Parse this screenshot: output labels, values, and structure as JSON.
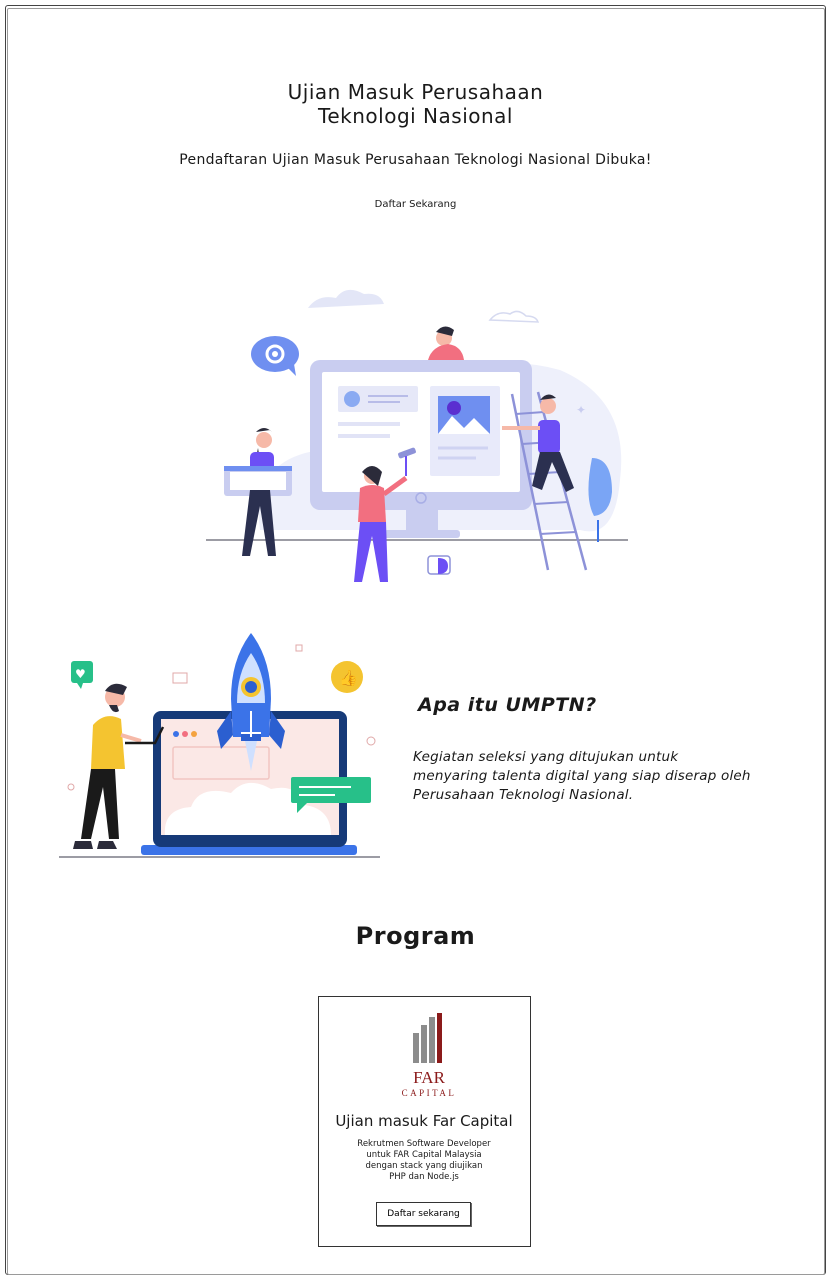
{
  "hero": {
    "title_line1": "Ujian Masuk Perusahaan",
    "title_line2": "Teknologi Nasional",
    "subtitle": "Pendaftaran Ujian Masuk Perusahaan Teknologi Nasional Dibuka!",
    "cta_label": "Daftar Sekarang"
  },
  "about": {
    "title": "Apa itu UMPTN?",
    "text_line1": "Kegiatan seleksi yang ditujukan untuk",
    "text_line2": "menyaring talenta digital yang siap diserap oleh",
    "text_line3": "Perusahaan Teknologi Nasional."
  },
  "program": {
    "title": "Program",
    "cards": [
      {
        "logo_word1": "FAR",
        "logo_word2": "CAPITAL",
        "title": "Ujian masuk Far Capital",
        "desc_line1": "Rekrutmen Software Developer",
        "desc_line2": "untuk FAR Capital Malaysia",
        "desc_line3": "dengan stack yang diujikan",
        "desc_line4": "PHP dan Node.js",
        "button_label": "Daftar sekarang"
      }
    ]
  },
  "colors": {
    "illus_purple": "#6c4ff5",
    "illus_blue": "#3b73e8",
    "illus_lavender": "#d8dcf4",
    "illus_pink": "#f26f80",
    "illus_yellow": "#f4c430",
    "illus_green": "#27c089",
    "logo_red": "#8b1a1a",
    "logo_gray": "#8c8c8c"
  }
}
